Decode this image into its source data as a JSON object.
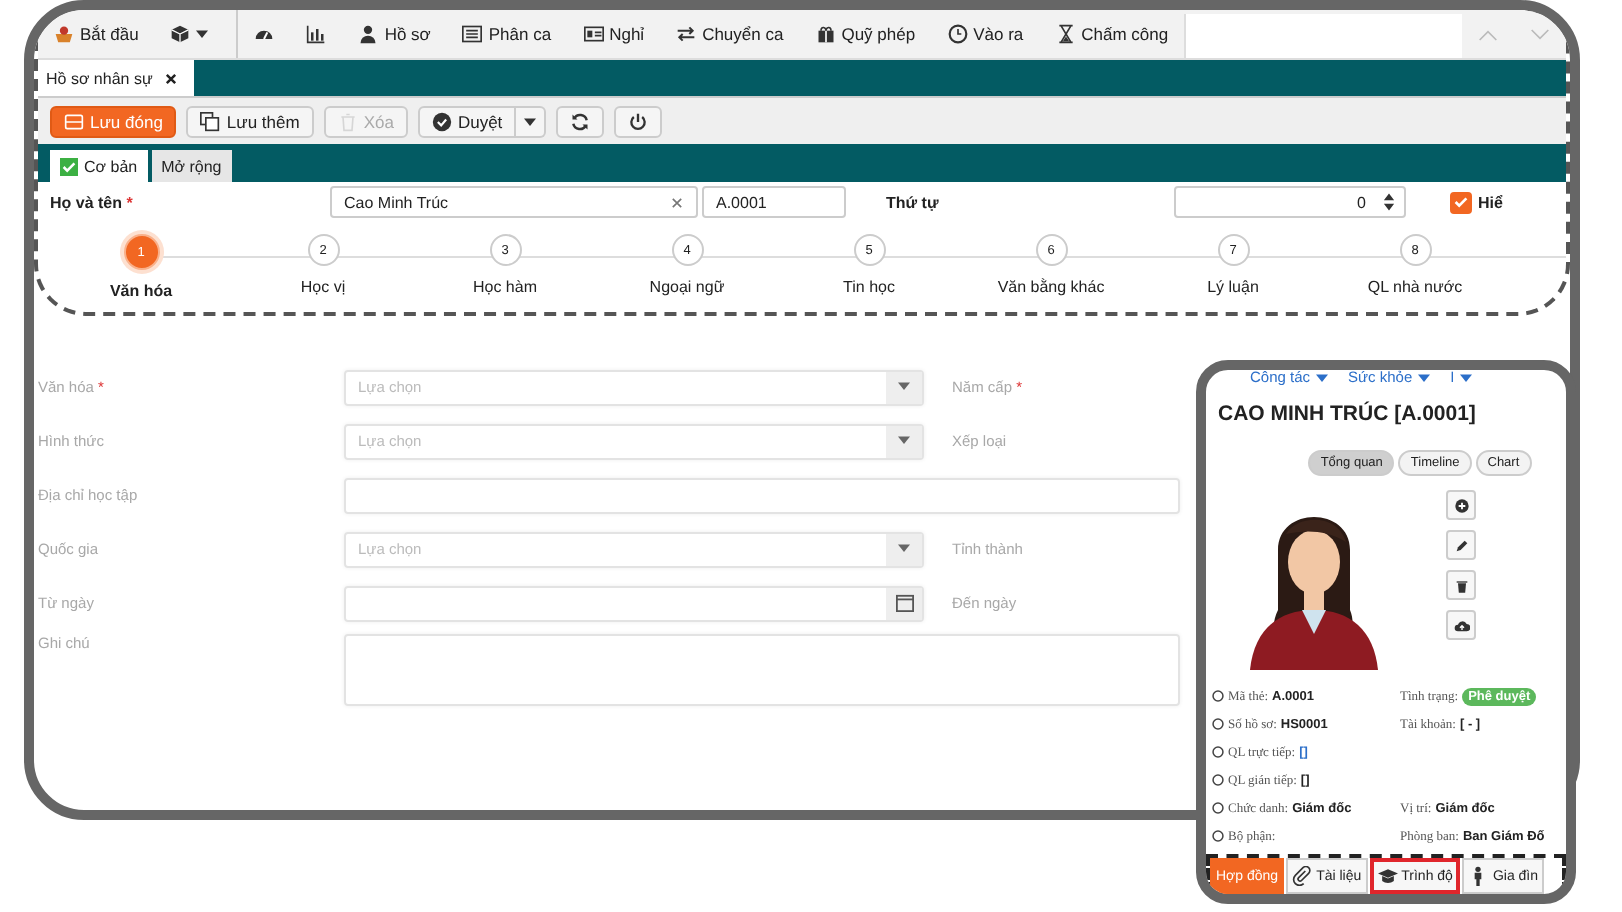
{
  "menu_bar": {
    "items": [
      {
        "kind": "start",
        "label": "Bắt đầu"
      },
      {
        "kind": "cube"
      },
      {
        "kind": "gauge"
      },
      {
        "kind": "chart"
      },
      {
        "kind": "person",
        "label": "Hồ sơ"
      },
      {
        "kind": "list",
        "label": "Phân ca"
      },
      {
        "kind": "card",
        "label": "Nghỉ"
      },
      {
        "kind": "swap",
        "label": "Chuyển ca"
      },
      {
        "kind": "gift",
        "label": "Quỹ phép"
      },
      {
        "kind": "clock",
        "label": "Vào ra"
      },
      {
        "kind": "hourglass",
        "label": "Chấm công"
      }
    ]
  },
  "tabs": [
    {
      "label": "Hồ sơ nhân sự",
      "selected": true
    }
  ],
  "toolbar": [
    {
      "kind": "primary",
      "label": "Lưu đóng",
      "disabled": false
    },
    {
      "kind": "copy",
      "label": "Lưu thêm",
      "disabled": false
    },
    {
      "kind": "trash",
      "label": "Xóa",
      "disabled": true
    },
    {
      "kind": "split",
      "label": "Duyệt",
      "disabled": false
    },
    {
      "kind": "refresh",
      "disabled": false
    },
    {
      "kind": "power",
      "disabled": false
    }
  ],
  "sub_tabs": [
    {
      "label": "Cơ bản",
      "selected": true
    },
    {
      "label": "Mở rộng",
      "selected": false
    }
  ],
  "header_form": {
    "name_label": "Họ và tên",
    "required_mark": "*",
    "name_value": "Cao Minh Trúc",
    "code_value": "A.0001",
    "order_label": "Thứ tự",
    "order_value": "0",
    "show_label": "Hiể",
    "show_checked": true
  },
  "steps": [
    {
      "number": "1",
      "label": "Văn hóa",
      "selected": true
    },
    {
      "number": "2",
      "label": "Học vị",
      "selected": false
    },
    {
      "number": "3",
      "label": "Học hàm",
      "selected": false
    },
    {
      "number": "4",
      "label": "Ngoại ngữ",
      "selected": false
    },
    {
      "number": "5",
      "label": "Tin học",
      "selected": false
    },
    {
      "number": "6",
      "label": "Văn bằng khác",
      "selected": false
    },
    {
      "number": "7",
      "label": "Lý luận",
      "selected": false
    },
    {
      "number": "8",
      "label": "QL nhà nước",
      "selected": false
    }
  ],
  "detail_form": [
    {
      "kind": "select",
      "label": "Văn hóa",
      "required_mark": "*",
      "placeholder": "Lựa chọn",
      "right_label": "Năm cấp",
      "right_required_mark": "*"
    },
    {
      "kind": "select",
      "label": "Hình thức",
      "placeholder": "Lựa chọn",
      "right_label": "Xếp loại"
    },
    {
      "kind": "text",
      "label": "Địa chỉ học tập"
    },
    {
      "kind": "select",
      "label": "Quốc gia",
      "placeholder": "Lựa chọn",
      "right_label": "Tỉnh thành"
    },
    {
      "kind": "date",
      "label": "Từ ngày",
      "right_label": "Đến ngày"
    },
    {
      "kind": "textarea",
      "label": "Ghi chú"
    }
  ],
  "profile_panel": {
    "top_links": [
      "Công tác",
      "Sức khỏe",
      "I"
    ],
    "title": "CAO MINH TRÚC [A.0001]",
    "view_tabs": [
      {
        "label": "Tổng quan",
        "selected": true
      },
      {
        "label": "Timeline",
        "selected": false
      },
      {
        "label": "Chart",
        "selected": false
      }
    ],
    "info_rows": [
      {
        "left": {
          "label": "Mã thẻ:",
          "value": "A.0001",
          "kind": "text"
        },
        "right": {
          "label": "Tình trạng:",
          "value": "Phê duyệt",
          "kind": "badge"
        }
      },
      {
        "left": {
          "label": "Số hồ sơ:",
          "value": "HS0001",
          "kind": "text"
        },
        "right": {
          "label": "Tài khoản:",
          "value": "[ - ]",
          "kind": "text"
        }
      },
      {
        "left": {
          "label": "QL trực tiếp:",
          "value": "[]",
          "kind": "link"
        }
      },
      {
        "left": {
          "label": "QL gián tiếp:",
          "value": "[]",
          "kind": "text"
        }
      },
      {
        "left": {
          "label": "Chức danh:",
          "value": "Giám đốc",
          "kind": "text"
        },
        "right": {
          "label": "Vị trí:",
          "value": "Giám đốc",
          "kind": "text"
        }
      },
      {
        "left": {
          "label": "Bộ phận:"
        },
        "right": {
          "label": "Phòng ban:",
          "value": "Ban Giám Đố",
          "kind": "text"
        }
      }
    ],
    "bottom_tabs": [
      {
        "kind": "contract",
        "label": "Hợp đồng",
        "selected": true,
        "highlighted": false
      },
      {
        "kind": "clip",
        "label": "Tài liệu",
        "selected": false,
        "highlighted": false
      },
      {
        "kind": "cap",
        "label": "Trình độ",
        "selected": false,
        "highlighted": true
      },
      {
        "kind": "family",
        "label": "Gia đìn",
        "selected": false,
        "highlighted": false
      }
    ]
  }
}
